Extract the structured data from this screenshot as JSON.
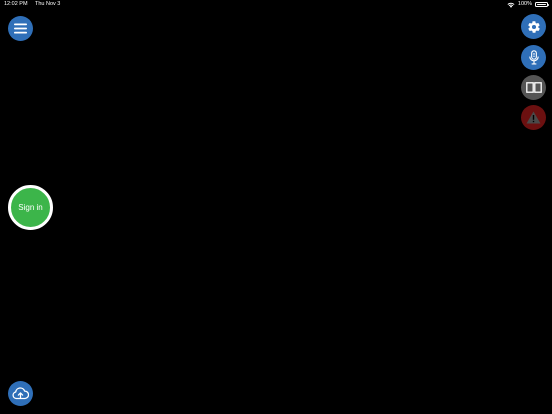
{
  "status_bar": {
    "time": "12:02 PM",
    "date": "Thu Nov 3",
    "battery": "100%",
    "wifi_icon": "wifi-icon",
    "battery_icon": "battery-icon"
  },
  "menu_button": {
    "icon": "hamburger-menu-icon"
  },
  "side_buttons": [
    {
      "icon": "gear-icon"
    },
    {
      "icon": "microphone-icon"
    },
    {
      "icon": "open-book-icon"
    },
    {
      "icon": "warning-icon"
    }
  ],
  "sign_in": {
    "label": "Sign in"
  },
  "upload_button": {
    "icon": "cloud-upload-icon"
  },
  "colors": {
    "background": "#000000",
    "accent_blue": "#2f6fb8",
    "book_button": "#555555",
    "warning_button": "#6b1010",
    "sign_in_green": "#3cb54a",
    "text": "#ffffff"
  }
}
